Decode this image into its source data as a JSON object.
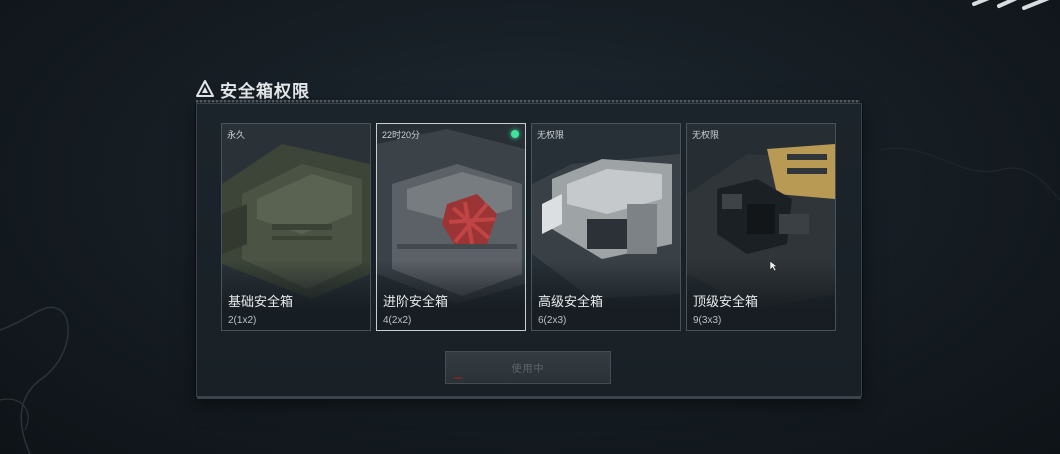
{
  "dialog": {
    "title": "安全箱权限",
    "icon": "warning-triangle-icon"
  },
  "cards": [
    {
      "tag": "永久",
      "name": "基础安全箱",
      "size": "2(1x2)",
      "selected": false,
      "active": false
    },
    {
      "tag": "22时20分",
      "name": "进阶安全箱",
      "size": "4(2x2)",
      "selected": true,
      "active": true
    },
    {
      "tag": "无权限",
      "name": "高级安全箱",
      "size": "6(2x3)",
      "selected": false,
      "active": false
    },
    {
      "tag": "无权限",
      "name": "顶级安全箱",
      "size": "9(3x3)",
      "selected": false,
      "active": false
    }
  ],
  "confirm_button": {
    "label": "使用中",
    "enabled": false
  },
  "colors": {
    "active_dot": "#3fe39a",
    "panel_bg": "#1c242b",
    "selected_border": "#c9ced2"
  }
}
